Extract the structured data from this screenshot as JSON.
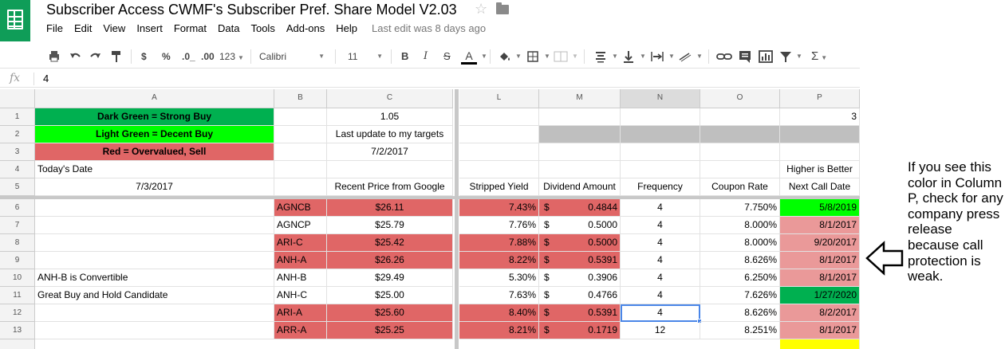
{
  "header": {
    "title": "Subscriber Access CWMF's Subscriber Pref. Share Model V2.03",
    "menus": [
      "File",
      "Edit",
      "View",
      "Insert",
      "Format",
      "Data",
      "Tools",
      "Add-ons",
      "Help"
    ],
    "last_edit": "Last edit was 8 days ago"
  },
  "toolbar": {
    "currency": "$",
    "percent": "%",
    "dec_decrease": ".0_",
    "dec_increase": ".00",
    "number_format": "123",
    "font": "Calibri",
    "font_size": "11",
    "bold": "B",
    "italic": "I",
    "strike": "S",
    "text_color": "A",
    "sum": "Σ"
  },
  "formula_bar": {
    "fx": "fx",
    "value": "4"
  },
  "columns": [
    "A",
    "B",
    "C",
    "L",
    "M",
    "N",
    "O",
    "P"
  ],
  "rows": [
    {
      "n": "1",
      "A": "Dark Green = Strong Buy",
      "B": "",
      "C": "1.05",
      "L": "",
      "M": "",
      "N": "",
      "O": "",
      "P": "3"
    },
    {
      "n": "2",
      "A": "Light Green = Decent Buy",
      "B": "",
      "C": "Last update to my targets",
      "L": "",
      "M": "",
      "N": "",
      "O": "",
      "P": ""
    },
    {
      "n": "3",
      "A": "Red = Overvalued, Sell",
      "B": "",
      "C": "7/2/2017",
      "L": "",
      "M": "",
      "N": "",
      "O": "",
      "P": ""
    },
    {
      "n": "4",
      "A": "Today's Date",
      "B": "",
      "C": "",
      "L": "",
      "M": "",
      "N": "",
      "O": "",
      "P": "Higher is Better"
    },
    {
      "n": "5",
      "A": "7/3/2017",
      "B": "",
      "C": "Recent Price from Google",
      "L": "Stripped Yield",
      "M": "Dividend Amount",
      "N": "Frequency",
      "O": "Coupon Rate",
      "P": "Next Call Date"
    },
    {
      "n": "6",
      "A": "",
      "B": "AGNCB",
      "C": "$26.11",
      "L": "7.43%",
      "M_sym": "$",
      "M": "0.4844",
      "N": "4",
      "O": "7.750%",
      "P": "5/8/2019"
    },
    {
      "n": "7",
      "A": "",
      "B": "AGNCP",
      "C": "$25.79",
      "L": "7.76%",
      "M_sym": "$",
      "M": "0.5000",
      "N": "4",
      "O": "8.000%",
      "P": "8/1/2017"
    },
    {
      "n": "8",
      "A": "",
      "B": "ARI-C",
      "C": "$25.42",
      "L": "7.88%",
      "M_sym": "$",
      "M": "0.5000",
      "N": "4",
      "O": "8.000%",
      "P": "9/20/2017"
    },
    {
      "n": "9",
      "A": "",
      "B": "ANH-A",
      "C": "$26.26",
      "L": "8.22%",
      "M_sym": "$",
      "M": "0.5391",
      "N": "4",
      "O": "8.626%",
      "P": "8/1/2017"
    },
    {
      "n": "10",
      "A": "ANH-B is Convertible",
      "B": "ANH-B",
      "C": "$29.49",
      "L": "5.30%",
      "M_sym": "$",
      "M": "0.3906",
      "N": "4",
      "O": "6.250%",
      "P": "8/1/2017"
    },
    {
      "n": "11",
      "A": "Great Buy and Hold Candidate",
      "B": "ANH-C",
      "C": "$25.00",
      "L": "7.63%",
      "M_sym": "$",
      "M": "0.4766",
      "N": "4",
      "O": "7.626%",
      "P": "1/27/2020"
    },
    {
      "n": "12",
      "A": "",
      "B": "ARI-A",
      "C": "$25.60",
      "L": "8.40%",
      "M_sym": "$",
      "M": "0.5391",
      "N": "4",
      "O": "8.626%",
      "P": "8/2/2017"
    },
    {
      "n": "13",
      "A": "",
      "B": "ARR-A",
      "C": "$25.25",
      "L": "8.21%",
      "M_sym": "$",
      "M": "0.1719",
      "N": "12",
      "O": "8.251%",
      "P": "8/1/2017"
    }
  ],
  "colors": {
    "dark_green": "#00b050",
    "light_green": "#00ff00",
    "red": "#e06666",
    "light_red": "#ea9999",
    "gray": "#bfbfbf",
    "yellow": "#ffff00",
    "selection": "#4a86e8"
  },
  "side_note": "If you see this color in Column P, check for any company press release because call protection is weak."
}
